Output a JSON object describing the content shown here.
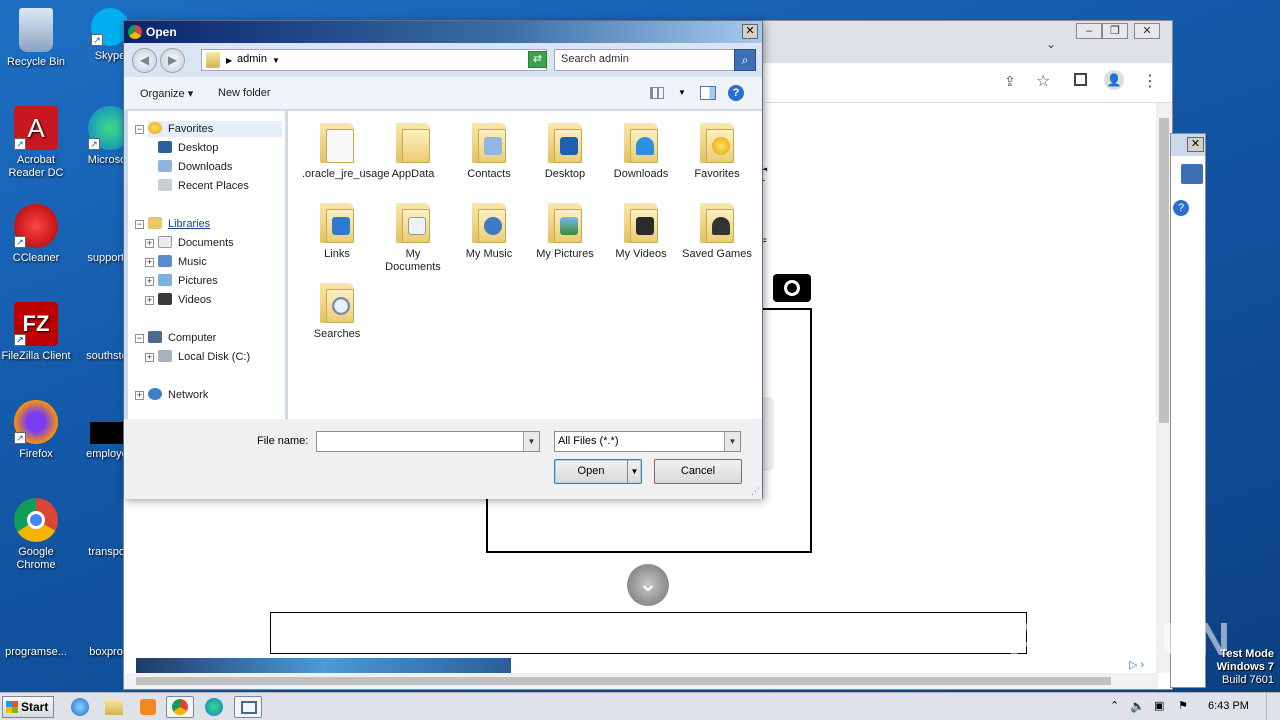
{
  "desktop": {
    "icons": [
      {
        "label": "Recycle Bin"
      },
      {
        "label": "Skype"
      },
      {
        "label": "Acrobat Reader DC"
      },
      {
        "label": "Microsoft"
      },
      {
        "label": "CCleaner"
      },
      {
        "label": "supportal"
      },
      {
        "label": "FileZilla Client"
      },
      {
        "label": "southstep"
      },
      {
        "label": "Firefox"
      },
      {
        "label": "employee"
      },
      {
        "label": "Google Chrome"
      },
      {
        "label": "transport"
      },
      {
        "label": "programse..."
      },
      {
        "label": "boxprovi"
      }
    ]
  },
  "dialog": {
    "title": "Open",
    "close": "✕",
    "breadcrumb": "admin",
    "search_placeholder": "Search admin",
    "toolbar": {
      "organize": "Organize",
      "new_folder": "New folder"
    },
    "nav": {
      "favorites": "Favorites",
      "desktop": "Desktop",
      "downloads": "Downloads",
      "recent": "Recent Places",
      "libraries": "Libraries",
      "documents": "Documents",
      "music": "Music",
      "pictures": "Pictures",
      "videos": "Videos",
      "computer": "Computer",
      "local_disk": "Local Disk (C:)",
      "network": "Network"
    },
    "folders": [
      {
        "label": ".oracle_jre_usage"
      },
      {
        "label": "AppData"
      },
      {
        "label": "Contacts"
      },
      {
        "label": "Desktop"
      },
      {
        "label": "Downloads"
      },
      {
        "label": "Favorites"
      },
      {
        "label": "Links"
      },
      {
        "label": "My Documents"
      },
      {
        "label": "My Music"
      },
      {
        "label": "My Pictures"
      },
      {
        "label": "My Videos"
      },
      {
        "label": "Saved Games"
      },
      {
        "label": "Searches"
      }
    ],
    "file_name_label": "File name:",
    "file_name_value": "",
    "file_type": "All Files (*.*)",
    "open_button": "Open",
    "cancel_button": "Cancel"
  },
  "browser": {
    "partial_text_r": "r",
    "partial_text_e": "e"
  },
  "taskbar": {
    "start_label": "Start",
    "time": "6:43 PM"
  },
  "watermark": "ANY RUN",
  "test_mode": {
    "line1": "Test Mode",
    "line2": "Windows 7",
    "line3": "Build 7601"
  }
}
